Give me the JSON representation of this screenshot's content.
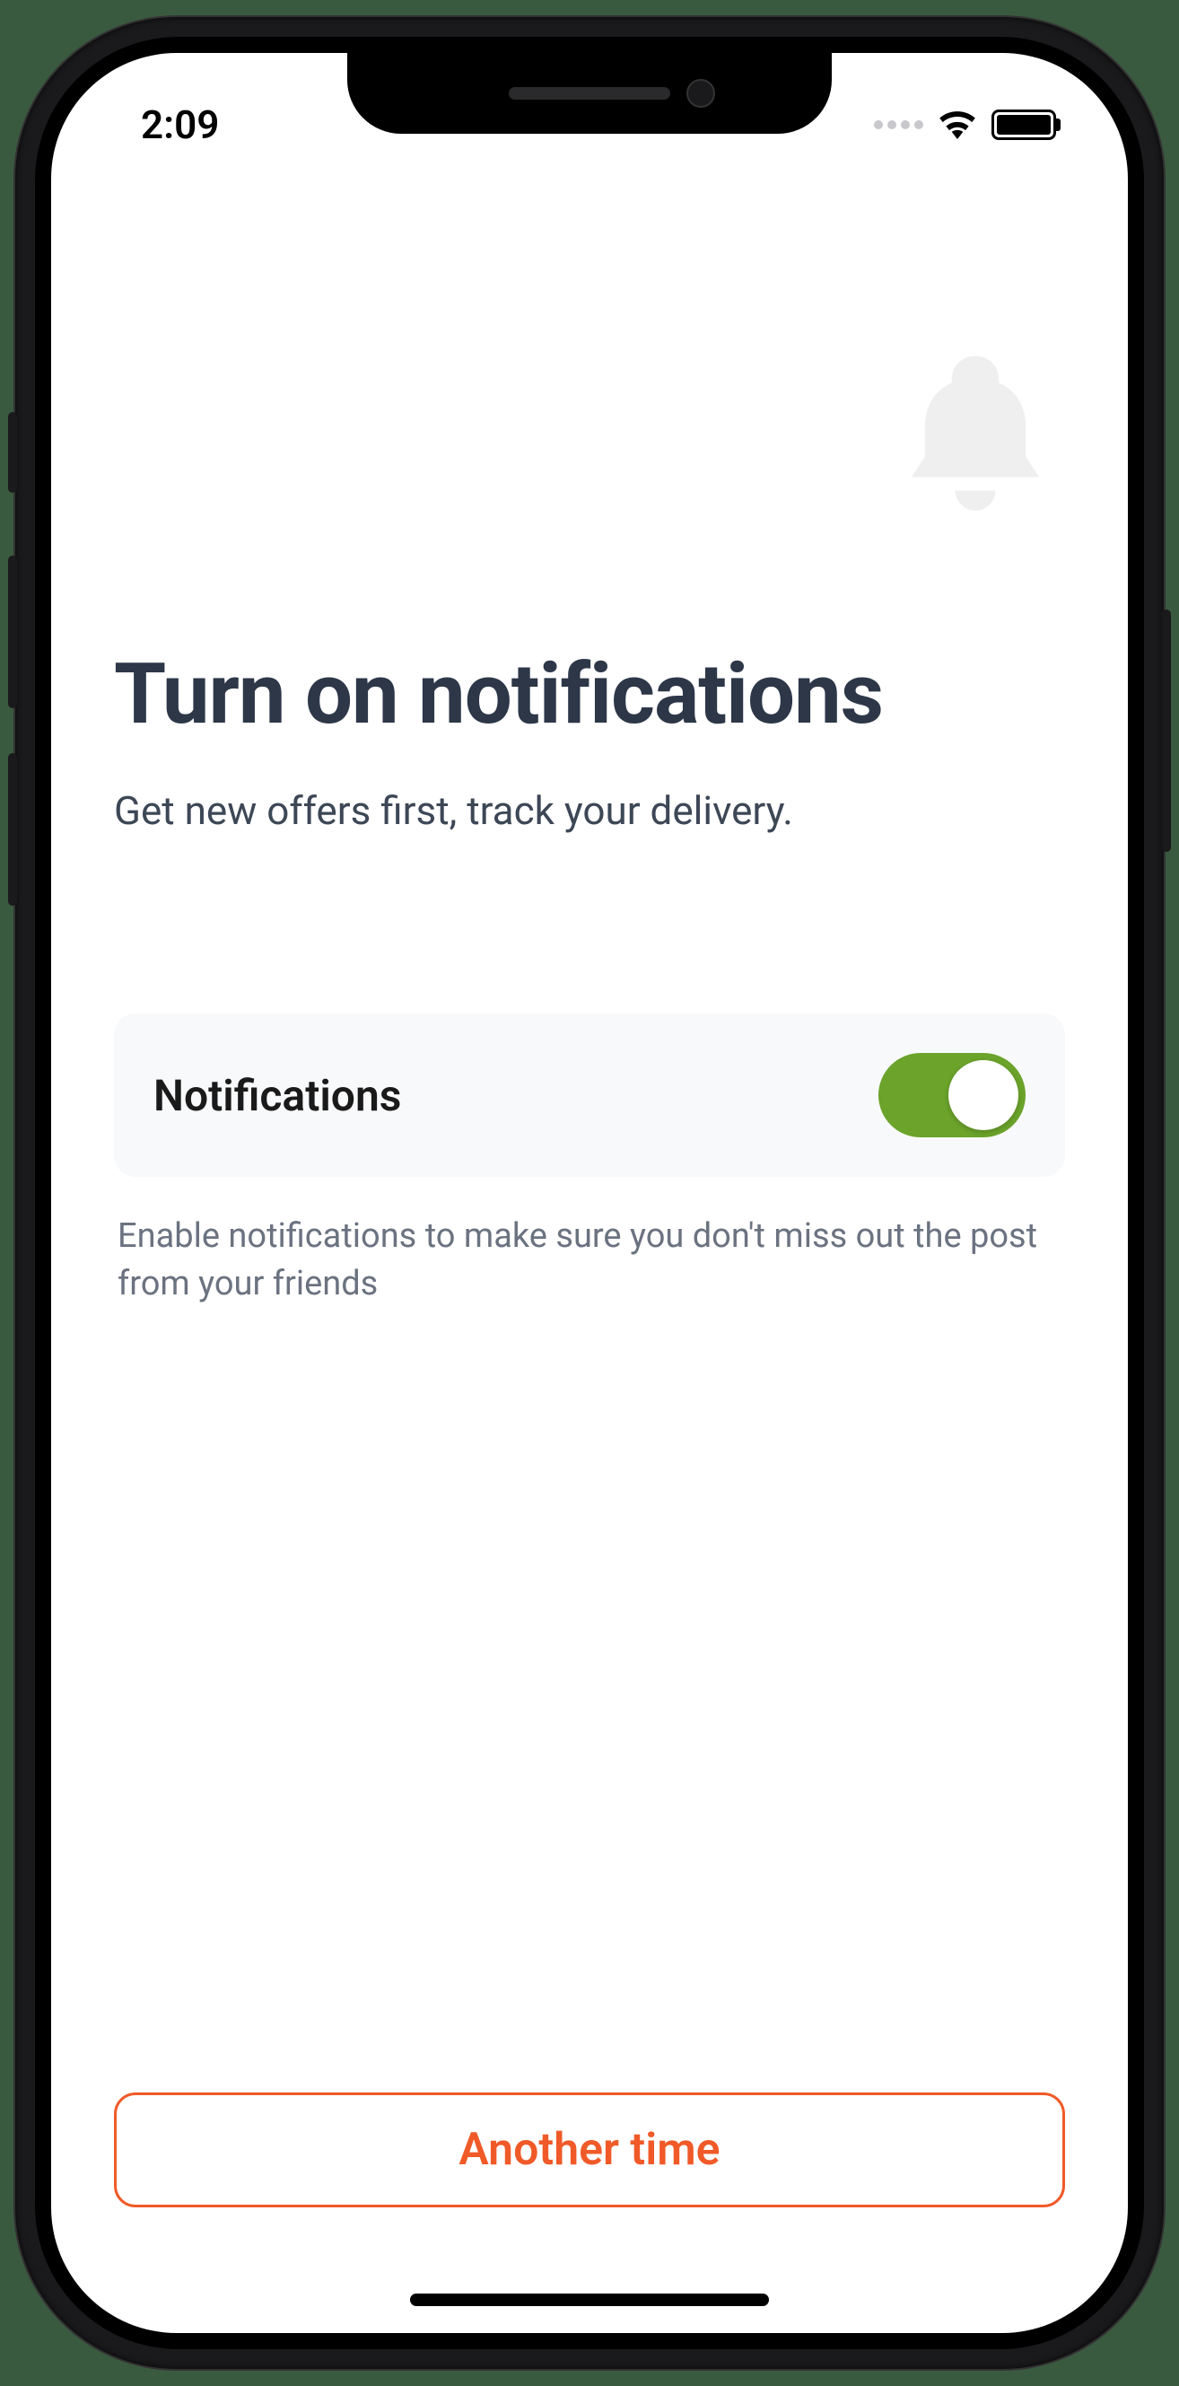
{
  "status": {
    "time": "2:09"
  },
  "page": {
    "heading": "Turn on notifications",
    "subheading": "Get new offers first, track your delivery."
  },
  "toggle": {
    "label": "Notifications",
    "enabled": true,
    "helpText": "Enable notifications to make sure you don't miss out the post from your friends"
  },
  "buttons": {
    "skip": "Another time"
  },
  "colors": {
    "accent": "#f05a28",
    "toggleOn": "#6ba32b",
    "heading": "#2d3748",
    "muted": "#6b7280"
  }
}
